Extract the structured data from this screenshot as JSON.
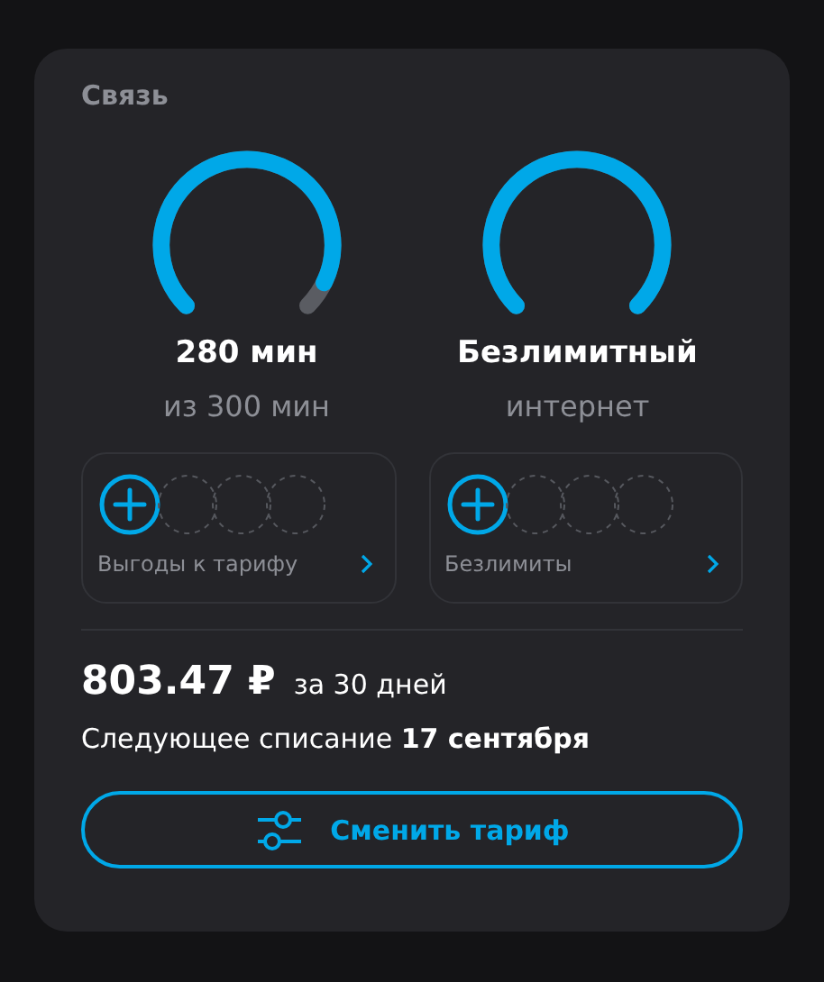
{
  "section": {
    "title": "Связь"
  },
  "gauges": [
    {
      "value": "280 мин",
      "caption": "из 300 мин",
      "level": 0.93
    },
    {
      "value": "Безлимитный",
      "caption": "интернет",
      "level": 1
    }
  ],
  "tiles": [
    {
      "label": "Выгоды к тарифу"
    },
    {
      "label": "Безлимиты"
    }
  ],
  "price": {
    "amount": "803.47 ₽",
    "period": "за 30 дней",
    "next": "Следующее списание **17 сентября**"
  },
  "button": {
    "label": "Сменить тариф"
  }
}
